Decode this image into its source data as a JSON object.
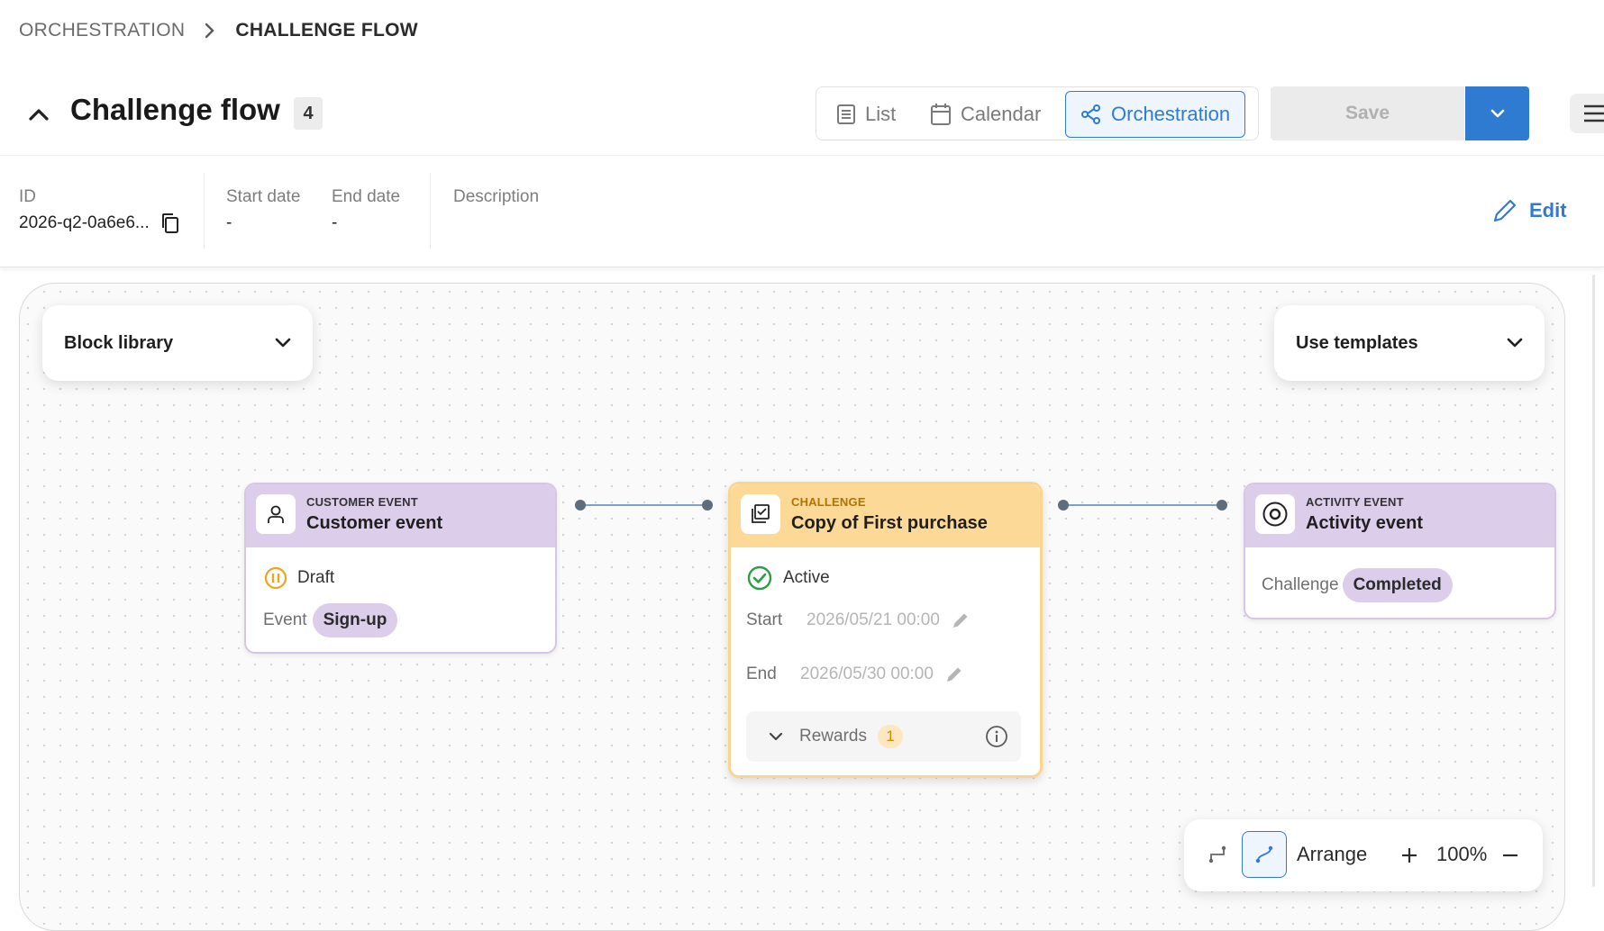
{
  "breadcrumb": {
    "items": [
      "ORCHESTRATION",
      "CHALLENGE FLOW"
    ]
  },
  "header": {
    "title": "Challenge flow",
    "count": "4"
  },
  "view_switch": {
    "items": [
      {
        "label": "List",
        "icon": "list-icon",
        "active": false
      },
      {
        "label": "Calendar",
        "icon": "calendar-icon",
        "active": false
      },
      {
        "label": "Orchestration",
        "icon": "orchestration-icon",
        "active": true
      }
    ]
  },
  "actions": {
    "save_label": "Save",
    "save_enabled": false
  },
  "info": {
    "id_label": "ID",
    "id_value": "2026-q2-0a6e6...",
    "start_label": "Start date",
    "start_value": "-",
    "end_label": "End date",
    "end_value": "-",
    "description_label": "Description",
    "edit_label": "Edit"
  },
  "canvas": {
    "block_library_label": "Block library",
    "templates_label": "Use templates",
    "nodes": [
      {
        "kind": "CUSTOMER EVENT",
        "name": "Customer event",
        "status": "Draft",
        "field_label": "Event",
        "field_value": "Sign-up"
      },
      {
        "kind": "CHALLENGE",
        "name": "Copy of First purchase",
        "status": "Active",
        "start_label": "Start",
        "start_value": "2026/05/21 00:00",
        "end_label": "End",
        "end_value": "2026/05/30 00:00",
        "rewards_label": "Rewards",
        "rewards_count": "1"
      },
      {
        "kind": "ACTIVITY EVENT",
        "name": "Activity event",
        "field_label": "Challenge",
        "field_value": "Completed"
      }
    ]
  },
  "toolbar": {
    "arrange_label": "Arrange",
    "zoom": "100%"
  },
  "colors": {
    "accent": "#2f7bd2",
    "purple_header": "#dccdea",
    "yellow_header": "#fcd996",
    "draft": "#f0a41c",
    "active": "#2e9e44"
  }
}
